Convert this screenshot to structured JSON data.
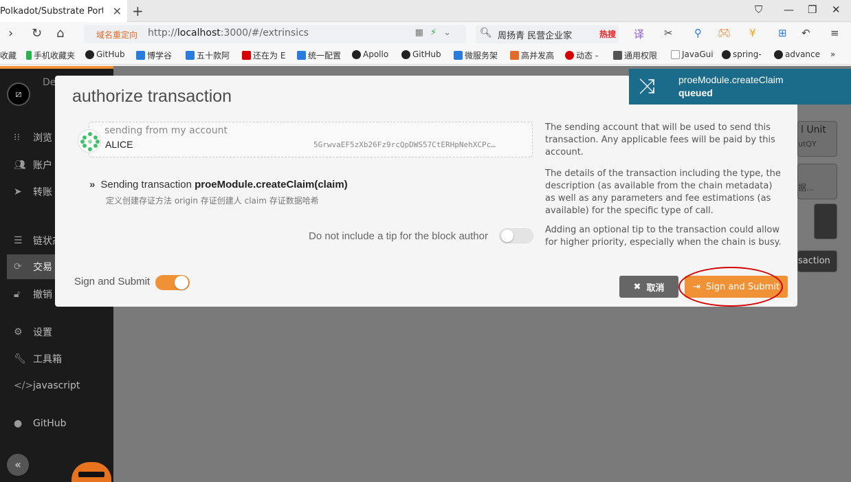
{
  "browser": {
    "tab_title": "Polkadot/Substrate Portal",
    "redirect_label": "域名重定向",
    "url_prefix": "http://",
    "url_host": "localhost",
    "url_rest": ":3000/#/extrinsics",
    "search_text": "周扬青 民营企业家",
    "search_hot": "热搜",
    "bookmarks": [
      "收藏",
      "手机收藏夹",
      "GitHub",
      "博学谷",
      "五十款阿",
      "还在为 E",
      "统一配置",
      "Apollo",
      "GitHub",
      "微服务架",
      "高并发高",
      "动态 -",
      "通用权限",
      "JavaGui",
      "spring-",
      "advance"
    ]
  },
  "sidebar": {
    "logo_label": "De",
    "items": [
      {
        "icon": "grid-icon",
        "label": "浏览"
      },
      {
        "icon": "users-icon",
        "label": "账户"
      },
      {
        "icon": "send-icon",
        "label": "转账"
      },
      {
        "icon": "database-icon",
        "label": "链状态"
      },
      {
        "icon": "sync-icon",
        "label": "交易"
      },
      {
        "icon": "unlock-icon",
        "label": "撤销"
      },
      {
        "icon": "cogs-icon",
        "label": "设置"
      },
      {
        "icon": "wrench-icon",
        "label": "工具箱"
      },
      {
        "icon": "code-icon",
        "label": "javascript"
      },
      {
        "icon": "github-icon",
        "label": "GitHub"
      }
    ]
  },
  "background": {
    "unit_label": "l Unit",
    "unit_sub": "utQY",
    "select_hint": "据...",
    "submit_hint": "saction"
  },
  "modal": {
    "title": "authorize transaction",
    "account_label": "sending from my account",
    "account_name": "ALICE",
    "account_address": "5GrwvaEF5zXb26Fz9rcQpDWS57CtERHpNehXCPc…",
    "help_account": "The sending account that will be used to send this transaction. Any applicable fees will be paid by this account.",
    "tx_prefix": "Sending transaction",
    "tx_call": "proeModule.createClaim(claim)",
    "tx_description": "定义创建存证方法 origin 存证创建人 claim 存证数据哈希",
    "help_details": "The details of the transaction including the type, the description (as available from the chain metadata) as well as any parameters and fee estimations (as available) for the specific type of call.",
    "tip_label": "Do not include a tip for the block author",
    "help_tip": "Adding an optional tip to the transaction could allow for higher priority, especially when the chain is busy.",
    "sign_toggle_label": "Sign and Submit",
    "cancel_label": "取消",
    "submit_label": "Sign and Submit"
  },
  "toast": {
    "call": "proeModule.createClaim",
    "status": "queued"
  },
  "colors": {
    "accent": "#f19135",
    "toast": "#1b6b8a",
    "highlight": "#d40000"
  }
}
